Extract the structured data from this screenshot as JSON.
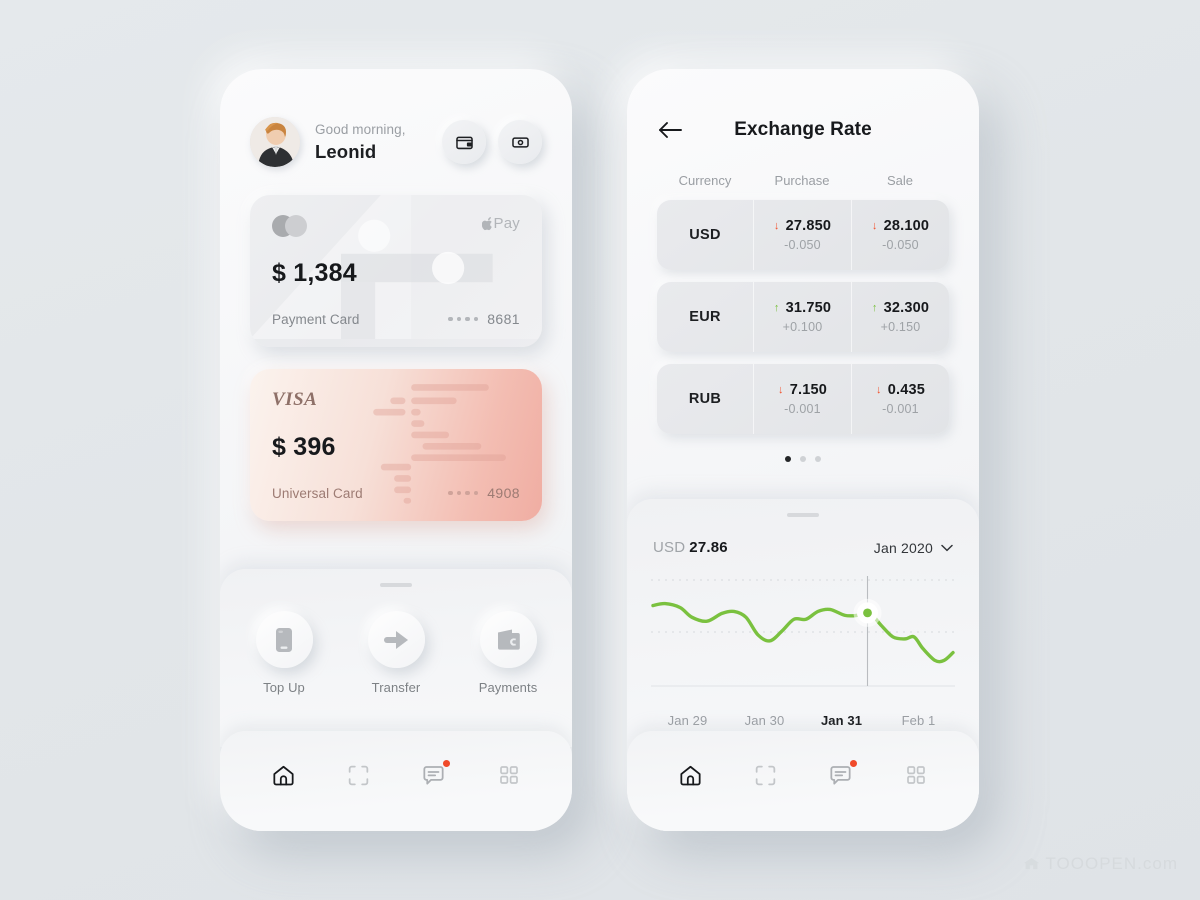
{
  "background_color": "#e3e7ea",
  "accent_colors": {
    "green": "#7ac13f",
    "red": "#f2502b",
    "notification": "#f04a2a",
    "text_dark": "#17191c",
    "text_muted": "#9a9ea3"
  },
  "home": {
    "greeting": "Good morning,",
    "user_name": "Leonid",
    "avatar": "user-avatar",
    "header_actions": [
      {
        "icon": "wallet-icon",
        "name": "wallet-button"
      },
      {
        "icon": "cash-icon",
        "name": "cash-button"
      }
    ],
    "cards": [
      {
        "brand": "mastercard",
        "brand_label": "",
        "pay_label": "Pay",
        "amount": "$ 1,384",
        "label": "Payment Card",
        "last4": "8681",
        "dots": "••••"
      },
      {
        "brand": "visa",
        "brand_label": "VISA",
        "pay_label": "",
        "amount": "$ 396",
        "label": "Universal Card",
        "last4": "4908",
        "dots": "••••"
      }
    ],
    "actions": [
      {
        "label": "Top Up",
        "icon": "phone-icon"
      },
      {
        "label": "Transfer",
        "icon": "arrow-right-icon"
      },
      {
        "label": "Payments",
        "icon": "wallet-filled-icon"
      }
    ]
  },
  "exchange": {
    "back_icon": "arrow-left-icon",
    "title": "Exchange Rate",
    "columns": [
      "Currency",
      "Purchase",
      "Sale"
    ],
    "rows": [
      {
        "currency": "USD",
        "purchase": {
          "value": "27.850",
          "delta": "-0.050",
          "direction": "down"
        },
        "sale": {
          "value": "28.100",
          "delta": "-0.050",
          "direction": "down"
        }
      },
      {
        "currency": "EUR",
        "purchase": {
          "value": "31.750",
          "delta": "+0.100",
          "direction": "up"
        },
        "sale": {
          "value": "32.300",
          "delta": "+0.150",
          "direction": "up"
        }
      },
      {
        "currency": "RUB",
        "purchase": {
          "value": "7.150",
          "delta": "-0.001",
          "direction": "down"
        },
        "sale": {
          "value": "0.435",
          "delta": "-0.001",
          "direction": "down"
        }
      }
    ],
    "pager": {
      "total": 3,
      "active": 0
    },
    "chart_header": {
      "currency": "USD",
      "rate": "27.86",
      "period": "Jan 2020",
      "chevron": "chevron-down-icon"
    }
  },
  "chart_data": {
    "type": "line",
    "title": "USD 27.86",
    "xlabel": "",
    "ylabel": "",
    "series": [
      {
        "name": "USD rate",
        "color": "#7ac13f",
        "points": [
          [
            0.0,
            0.78
          ],
          [
            0.04,
            0.8
          ],
          [
            0.09,
            0.76
          ],
          [
            0.13,
            0.66
          ],
          [
            0.18,
            0.62
          ],
          [
            0.23,
            0.7
          ],
          [
            0.27,
            0.72
          ],
          [
            0.31,
            0.66
          ],
          [
            0.35,
            0.48
          ],
          [
            0.39,
            0.42
          ],
          [
            0.43,
            0.52
          ],
          [
            0.47,
            0.64
          ],
          [
            0.51,
            0.64
          ],
          [
            0.55,
            0.72
          ],
          [
            0.59,
            0.74
          ],
          [
            0.64,
            0.68
          ],
          [
            0.68,
            0.68
          ],
          [
            0.72,
            0.71
          ],
          [
            0.76,
            0.58
          ],
          [
            0.8,
            0.46
          ],
          [
            0.84,
            0.44
          ],
          [
            0.87,
            0.46
          ],
          [
            0.9,
            0.34
          ],
          [
            0.94,
            0.22
          ],
          [
            0.97,
            0.22
          ],
          [
            1.0,
            0.3
          ]
        ]
      }
    ],
    "marker": {
      "x": 0.715,
      "y": 0.705,
      "label": "Jan 31"
    },
    "x_ticks": [
      "Jan 29",
      "Jan 30",
      "Jan 31",
      "Feb 1"
    ],
    "active_tick": "Jan 31",
    "gridlines": {
      "horizontal": 2,
      "style": "dotted"
    },
    "legend": "none"
  },
  "navbar": {
    "items": [
      {
        "icon": "home-icon",
        "active": true,
        "badge": false
      },
      {
        "icon": "scan-icon",
        "active": false,
        "badge": false
      },
      {
        "icon": "chat-icon",
        "active": false,
        "badge": true
      },
      {
        "icon": "grid-icon",
        "active": false,
        "badge": false
      }
    ]
  },
  "watermark": {
    "text": "TOOOPEN.com",
    "icon": "toopen-logo-icon"
  }
}
